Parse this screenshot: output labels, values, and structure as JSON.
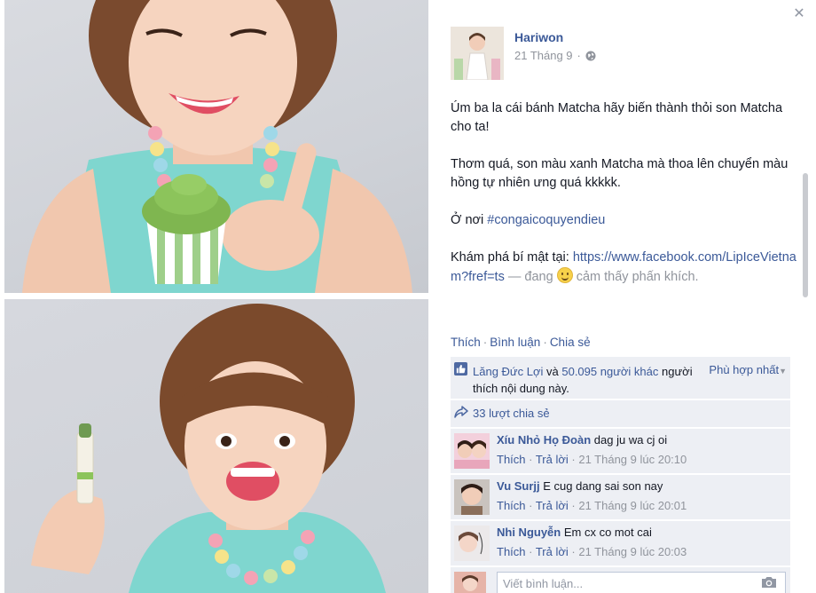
{
  "post": {
    "author": "Hariwon",
    "date": "21 Tháng 9",
    "date_sep": "·",
    "body": {
      "p1": "Úm ba la cái bánh Matcha hãy biến thành thỏi son Matcha cho ta!",
      "p2": "Thơm quá, son màu xanh Matcha mà thoa lên chuyển màu hồng tự nhiên ưng quá kkkkk.",
      "p3_prefix": "Ở nơi ",
      "p3_hashtag": "#congaicoquyendieu",
      "p4_prefix": "Khám phá bí mật tại: ",
      "p4_link": "https://www.facebook.com/LipIceVietnam?fref=ts",
      "p4_feeling_prefix": " — đang ",
      "p4_feeling_suffix": " cảm thấy phấn khích."
    }
  },
  "actions": {
    "like": "Thích",
    "comment": "Bình luận",
    "share": "Chia sẻ",
    "sep": "·"
  },
  "likes": {
    "name": "Lăng Đức Lợi",
    "and": " và ",
    "others": "50.095 người khác",
    "suffix": " người thích nội dung này.",
    "sort_label": "Phù hợp nhất"
  },
  "shares": {
    "label": "33 lượt chia sẻ"
  },
  "comments": [
    {
      "name": "Xíu Nhỏ Họ Đoàn",
      "text": "dag ju wa cj oi",
      "like": "Thích",
      "reply": "Trả lời",
      "time": "21 Tháng 9 lúc 20:10"
    },
    {
      "name": "Vu Surjj",
      "text": "E cug dang sai son nay",
      "like": "Thích",
      "reply": "Trả lời",
      "time": "21 Tháng 9 lúc 20:01"
    },
    {
      "name": "Nhi Nguyễn",
      "text": "Em cx co mot cai",
      "like": "Thích",
      "reply": "Trả lời",
      "time": "21 Tháng 9 lúc 20:03"
    }
  ],
  "composer": {
    "placeholder": "Viết bình luận..."
  },
  "icons": {
    "close": "close-icon",
    "globe": "globe-icon",
    "like": "like-thumb-icon",
    "share": "share-icon",
    "camera": "camera-icon"
  },
  "colors": {
    "link": "#3b5998",
    "muted": "#90949c",
    "ufi_bg": "#edeff4"
  }
}
